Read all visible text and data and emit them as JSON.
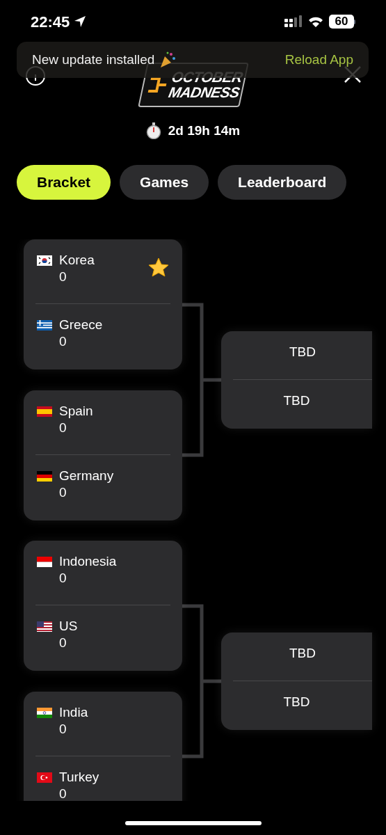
{
  "status_bar": {
    "time": "22:45",
    "battery": "60"
  },
  "banner": {
    "message": "New update installed",
    "action": "Reload App"
  },
  "logo": {
    "line_1": "OCTOBER",
    "line_2": "MADNESS"
  },
  "countdown": "2d 19h 14m",
  "tabs": [
    {
      "label": "Bracket",
      "selected": true
    },
    {
      "label": "Games",
      "selected": false
    },
    {
      "label": "Leaderboard",
      "selected": false
    }
  ],
  "bracket": [
    {
      "matches": [
        {
          "teams": [
            {
              "name": "Korea",
              "score": "0",
              "kind": "kr",
              "favorite": true
            },
            {
              "name": "Greece",
              "score": "0",
              "kind": "gr",
              "favorite": false
            }
          ]
        },
        {
          "teams": [
            {
              "name": "Spain",
              "score": "0",
              "kind": "es",
              "favorite": false
            },
            {
              "name": "Germany",
              "score": "0",
              "kind": "de",
              "favorite": false
            }
          ]
        }
      ],
      "next": [
        "TBD",
        "TBD"
      ]
    },
    {
      "matches": [
        {
          "teams": [
            {
              "name": "Indonesia",
              "score": "0",
              "kind": "id",
              "favorite": false
            },
            {
              "name": "US",
              "score": "0",
              "kind": "us",
              "favorite": false
            }
          ]
        },
        {
          "teams": [
            {
              "name": "India",
              "score": "0",
              "kind": "in",
              "favorite": false
            },
            {
              "name": "Turkey",
              "score": "0",
              "kind": "tr",
              "favorite": false
            }
          ]
        }
      ],
      "next": [
        "TBD",
        "TBD"
      ]
    }
  ]
}
